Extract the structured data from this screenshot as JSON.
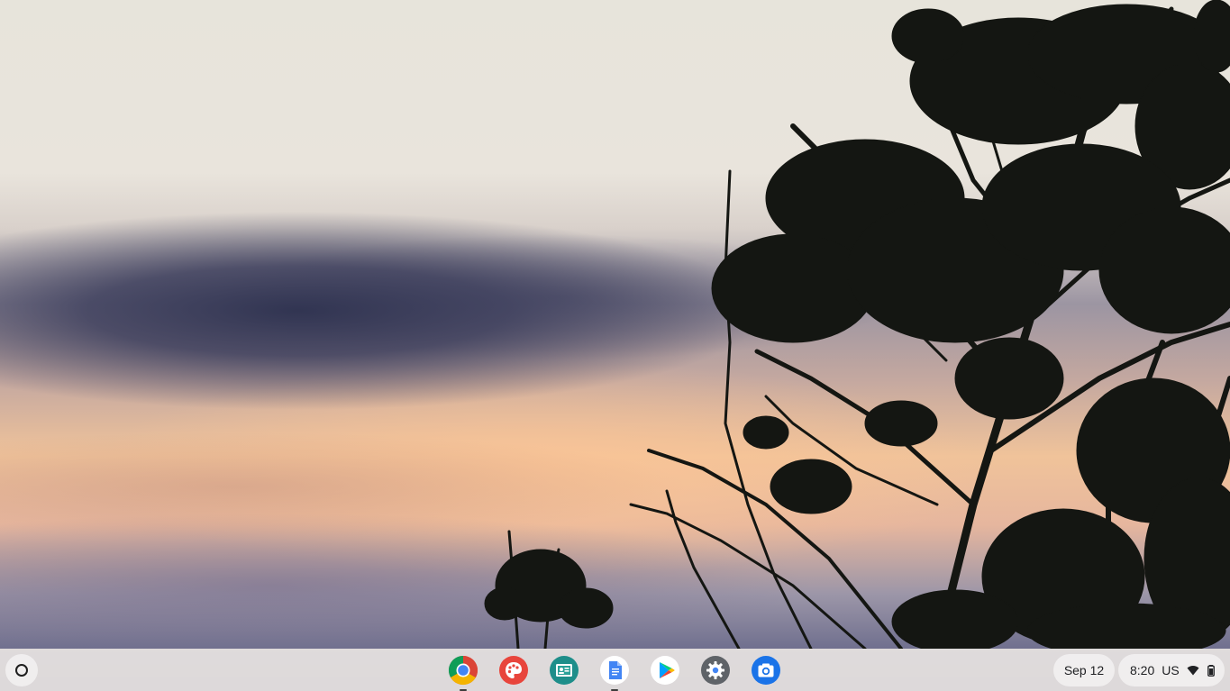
{
  "shelf": {
    "apps": [
      {
        "id": "chrome",
        "icon": "chrome-icon",
        "running": true
      },
      {
        "id": "canvas",
        "icon": "palette-icon",
        "running": false
      },
      {
        "id": "classroom",
        "icon": "classroom-icon",
        "running": false
      },
      {
        "id": "docs",
        "icon": "docs-icon",
        "running": true
      },
      {
        "id": "play-store",
        "icon": "play-store-icon",
        "running": false
      },
      {
        "id": "settings",
        "icon": "gear-icon",
        "running": false
      },
      {
        "id": "camera",
        "icon": "camera-icon",
        "running": false
      }
    ],
    "date": "Sep 12",
    "time": "8:20",
    "ime": "US",
    "status_icons": [
      "wifi-icon",
      "battery-icon"
    ]
  },
  "colors": {
    "shelf_bg": "#e8e4e2",
    "chrome_red": "#db4437",
    "chrome_yellow": "#f4b400",
    "chrome_green": "#0f9d58",
    "chrome_blue": "#4285f4",
    "canvas_red": "#e8453c",
    "classroom_teal": "#1e8e8a",
    "settings_gray": "#5f6368",
    "camera_blue": "#1a73e8"
  }
}
